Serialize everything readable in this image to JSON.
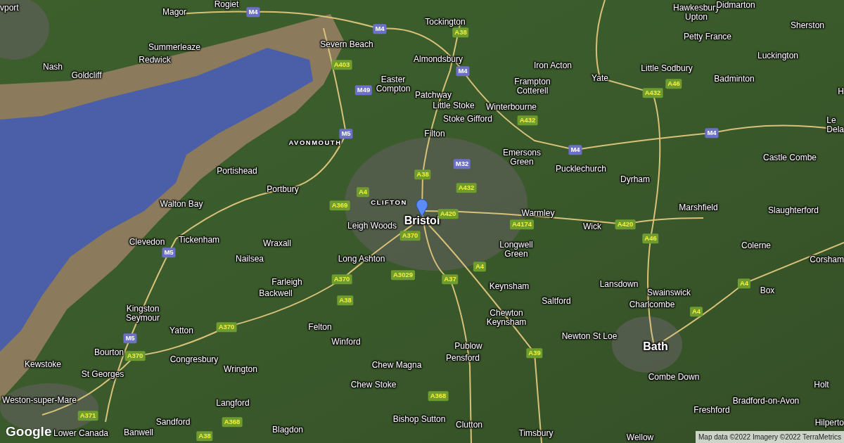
{
  "map": {
    "places": [
      {
        "name": "vport",
        "kind": "town"
      },
      {
        "name": "Rogiet",
        "kind": "town"
      },
      {
        "name": "Magor",
        "kind": "town"
      },
      {
        "name": "Summerleaze",
        "kind": "town"
      },
      {
        "name": "Redwick",
        "kind": "town"
      },
      {
        "name": "Nash",
        "kind": "town"
      },
      {
        "name": "Goldcliff",
        "kind": "town"
      },
      {
        "name": "Severn Beach",
        "kind": "town"
      },
      {
        "name": "Tockington",
        "kind": "town"
      },
      {
        "name": "Almondsbury",
        "kind": "town"
      },
      {
        "name": "Easter\nCompton",
        "kind": "town"
      },
      {
        "name": "Patchway",
        "kind": "town"
      },
      {
        "name": "Little Stoke",
        "kind": "town"
      },
      {
        "name": "Stoke Gifford",
        "kind": "town"
      },
      {
        "name": "Filton",
        "kind": "town"
      },
      {
        "name": "AVONMOUTH",
        "kind": "district"
      },
      {
        "name": "Iron Acton",
        "kind": "town"
      },
      {
        "name": "Frampton\nCotterell",
        "kind": "town"
      },
      {
        "name": "Winterbourne",
        "kind": "town"
      },
      {
        "name": "Emersons\nGreen",
        "kind": "town"
      },
      {
        "name": "Yate",
        "kind": "town"
      },
      {
        "name": "Hawkesbury\nUpton",
        "kind": "town"
      },
      {
        "name": "Didmarton",
        "kind": "town"
      },
      {
        "name": "Petty France",
        "kind": "town"
      },
      {
        "name": "Sherston",
        "kind": "town"
      },
      {
        "name": "Luckington",
        "kind": "town"
      },
      {
        "name": "Little Sodbury",
        "kind": "town"
      },
      {
        "name": "Badminton",
        "kind": "town"
      },
      {
        "name": "H",
        "kind": "town"
      },
      {
        "name": "Le\nDela",
        "kind": "town"
      },
      {
        "name": "Castle Combe",
        "kind": "town"
      },
      {
        "name": "Pucklechurch",
        "kind": "town"
      },
      {
        "name": "Dyrham",
        "kind": "town"
      },
      {
        "name": "Marshfield",
        "kind": "town"
      },
      {
        "name": "Slaughterford",
        "kind": "town"
      },
      {
        "name": "Portishead",
        "kind": "town"
      },
      {
        "name": "Portbury",
        "kind": "town"
      },
      {
        "name": "Walton Bay",
        "kind": "town"
      },
      {
        "name": "CLIFTON",
        "kind": "district"
      },
      {
        "name": "Bristol",
        "kind": "city"
      },
      {
        "name": "Leigh Woods",
        "kind": "town"
      },
      {
        "name": "Warmley",
        "kind": "town"
      },
      {
        "name": "Wick",
        "kind": "town"
      },
      {
        "name": "Clevedon",
        "kind": "town"
      },
      {
        "name": "Tickenham",
        "kind": "town"
      },
      {
        "name": "Wraxall",
        "kind": "town"
      },
      {
        "name": "Nailsea",
        "kind": "town"
      },
      {
        "name": "Long Ashton",
        "kind": "town"
      },
      {
        "name": "Farleigh",
        "kind": "town"
      },
      {
        "name": "Backwell",
        "kind": "town"
      },
      {
        "name": "Longwell\nGreen",
        "kind": "town"
      },
      {
        "name": "Keynsham",
        "kind": "town"
      },
      {
        "name": "Saltford",
        "kind": "town"
      },
      {
        "name": "Chewton\nKeynsham",
        "kind": "town"
      },
      {
        "name": "Lansdown",
        "kind": "town"
      },
      {
        "name": "Swainswick",
        "kind": "town"
      },
      {
        "name": "Charlcombe",
        "kind": "town"
      },
      {
        "name": "Newton St Loe",
        "kind": "town"
      },
      {
        "name": "Bath",
        "kind": "city"
      },
      {
        "name": "Colerne",
        "kind": "town"
      },
      {
        "name": "Corsham",
        "kind": "town"
      },
      {
        "name": "Box",
        "kind": "town"
      },
      {
        "name": "Kingston\nSeymour",
        "kind": "town"
      },
      {
        "name": "Yatton",
        "kind": "town"
      },
      {
        "name": "Felton",
        "kind": "town"
      },
      {
        "name": "Winford",
        "kind": "town"
      },
      {
        "name": "Publow",
        "kind": "town"
      },
      {
        "name": "Pensford",
        "kind": "town"
      },
      {
        "name": "Chew Magna",
        "kind": "town"
      },
      {
        "name": "Chew Stoke",
        "kind": "town"
      },
      {
        "name": "Bourton",
        "kind": "town"
      },
      {
        "name": "Congresbury",
        "kind": "town"
      },
      {
        "name": "Wrington",
        "kind": "town"
      },
      {
        "name": "Kewstoke",
        "kind": "town"
      },
      {
        "name": "St Georges",
        "kind": "town"
      },
      {
        "name": "Weston-super-Mare",
        "kind": "town"
      },
      {
        "name": "Langford",
        "kind": "town"
      },
      {
        "name": "Sandford",
        "kind": "town"
      },
      {
        "name": "Lower Canada",
        "kind": "town"
      },
      {
        "name": "Banwell",
        "kind": "town"
      },
      {
        "name": "Blagdon",
        "kind": "town"
      },
      {
        "name": "Bishop Sutton",
        "kind": "town"
      },
      {
        "name": "Clutton",
        "kind": "town"
      },
      {
        "name": "Timsbury",
        "kind": "town"
      },
      {
        "name": "Combe Down",
        "kind": "town"
      },
      {
        "name": "Freshford",
        "kind": "town"
      },
      {
        "name": "Wellow",
        "kind": "town"
      },
      {
        "name": "Bradford-on-Avon",
        "kind": "town"
      },
      {
        "name": "Holt",
        "kind": "town"
      },
      {
        "name": "Hilperto",
        "kind": "town"
      }
    ],
    "road_shields": [
      {
        "label": "M4",
        "kind": "motorway"
      },
      {
        "label": "M4",
        "kind": "motorway"
      },
      {
        "label": "M4",
        "kind": "motorway"
      },
      {
        "label": "M4",
        "kind": "motorway"
      },
      {
        "label": "M4",
        "kind": "motorway"
      },
      {
        "label": "M49",
        "kind": "motorway"
      },
      {
        "label": "M5",
        "kind": "motorway"
      },
      {
        "label": "M32",
        "kind": "motorway"
      },
      {
        "label": "M5",
        "kind": "motorway"
      },
      {
        "label": "M5",
        "kind": "motorway"
      },
      {
        "label": "A38",
        "kind": "a_road"
      },
      {
        "label": "A403",
        "kind": "a_road"
      },
      {
        "label": "A432",
        "kind": "a_road"
      },
      {
        "label": "A432",
        "kind": "a_road"
      },
      {
        "label": "A46",
        "kind": "a_road"
      },
      {
        "label": "A38",
        "kind": "a_road"
      },
      {
        "label": "A4",
        "kind": "a_road"
      },
      {
        "label": "A369",
        "kind": "a_road"
      },
      {
        "label": "A432",
        "kind": "a_road"
      },
      {
        "label": "A420",
        "kind": "a_road"
      },
      {
        "label": "A4174",
        "kind": "a_road"
      },
      {
        "label": "A420",
        "kind": "a_road"
      },
      {
        "label": "A46",
        "kind": "a_road"
      },
      {
        "label": "A370",
        "kind": "a_road"
      },
      {
        "label": "A370",
        "kind": "a_road"
      },
      {
        "label": "A3029",
        "kind": "a_road"
      },
      {
        "label": "A37",
        "kind": "a_road"
      },
      {
        "label": "A4",
        "kind": "a_road"
      },
      {
        "label": "A38",
        "kind": "a_road"
      },
      {
        "label": "A370",
        "kind": "a_road"
      },
      {
        "label": "A370",
        "kind": "a_road"
      },
      {
        "label": "A371",
        "kind": "a_road"
      },
      {
        "label": "A368",
        "kind": "a_road"
      },
      {
        "label": "A38",
        "kind": "a_road"
      },
      {
        "label": "A368",
        "kind": "a_road"
      },
      {
        "label": "A39",
        "kind": "a_road"
      },
      {
        "label": "A4",
        "kind": "a_road"
      },
      {
        "label": "A4",
        "kind": "a_road"
      }
    ],
    "logo": "Google",
    "attribution": "Map data ©2022 Imagery ©2022 TerraMetrics"
  }
}
